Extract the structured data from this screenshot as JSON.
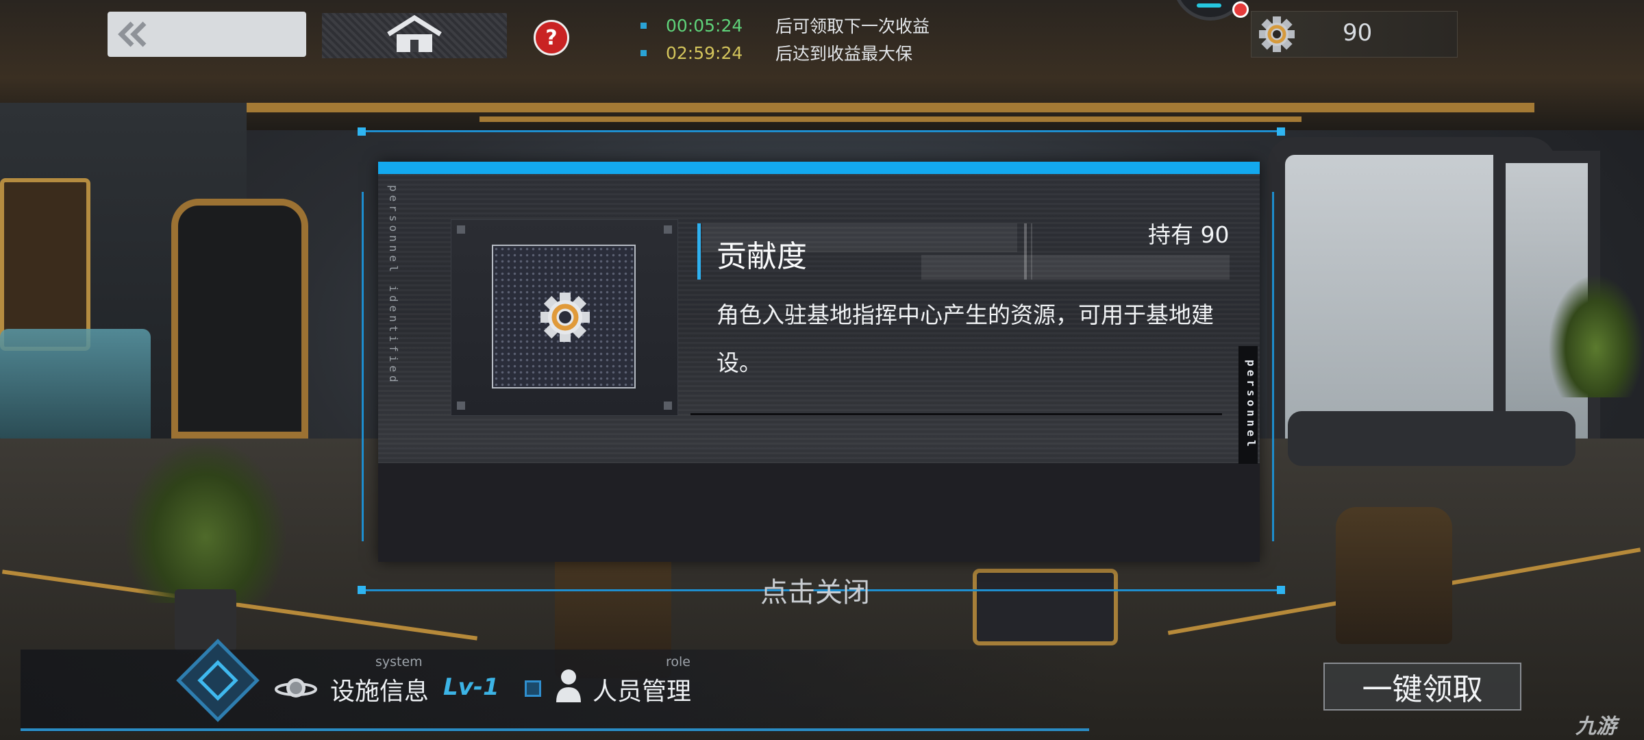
{
  "top": {
    "timers": [
      {
        "time": "00:05:24",
        "text": "后可领取下一次收益"
      },
      {
        "time": "02:59:24",
        "text": "后达到收益最大保"
      }
    ],
    "resource_count": "90"
  },
  "dialog": {
    "title": "贡献度",
    "held": "持有 90",
    "description": "角色入驻基地指挥中心产生的资源，可用于基地建设。",
    "side_text_left": "personnel identified",
    "side_text_right": "personnel",
    "close_hint": "点击关闭"
  },
  "bottom": {
    "system_label": "system",
    "facility_info": "设施信息",
    "level": "Lv-1",
    "role_label": "role",
    "personnel_management": "人员管理",
    "collect_all": "一键领取"
  },
  "watermark": "九游",
  "colors": {
    "accent_blue": "#13a9ef",
    "timer_green": "#5fd37a",
    "timer_yellow": "#d4c55c",
    "help_red": "#c92323"
  },
  "icons": {
    "back": "double-chevron-left-icon",
    "home": "home-icon",
    "help": "question-mark-icon",
    "resource": "gear-icon",
    "system": "planet-icon",
    "role": "person-icon"
  }
}
